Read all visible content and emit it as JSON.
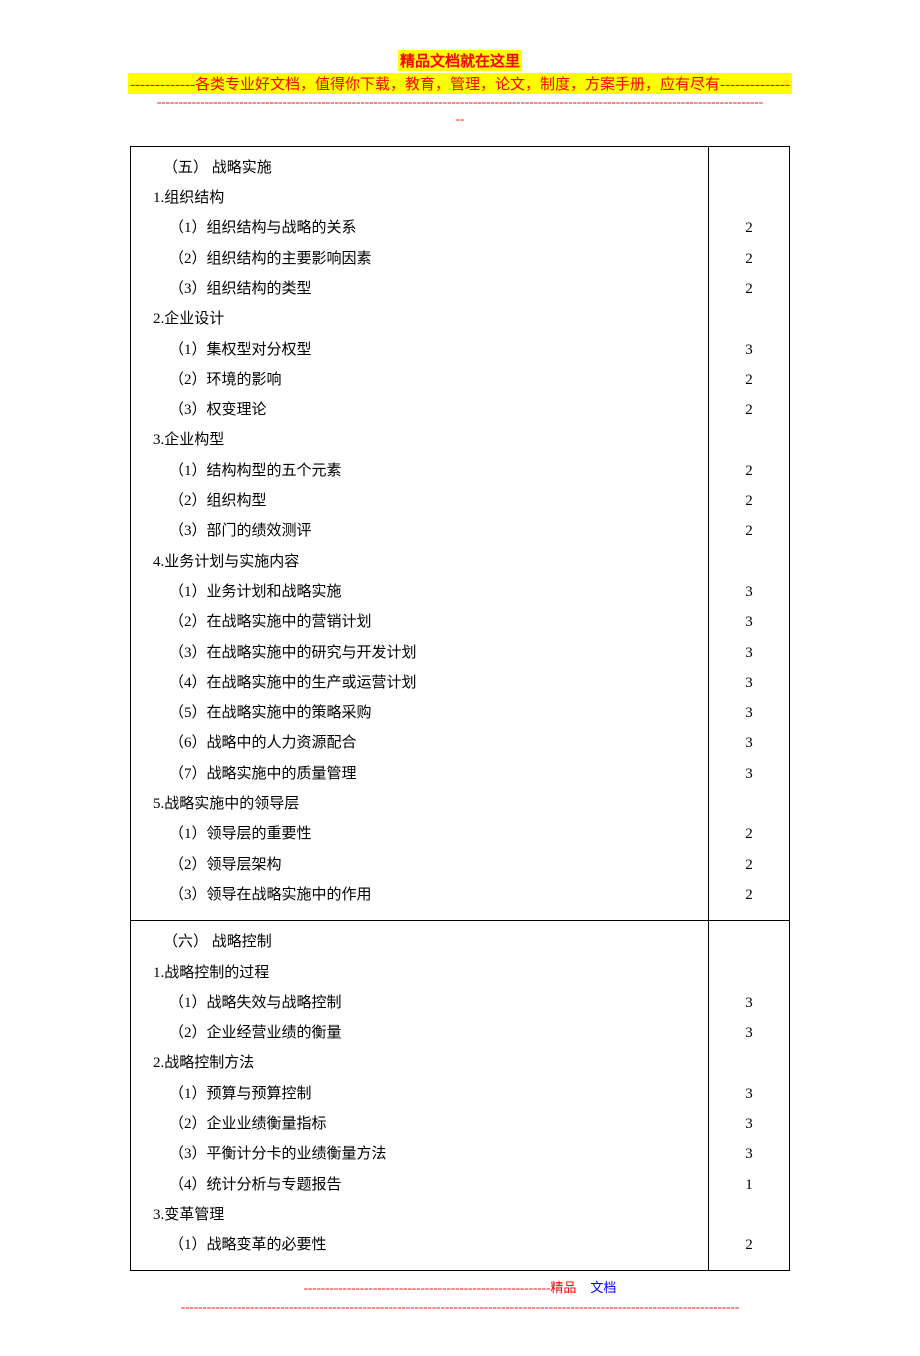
{
  "header": {
    "title": "精品文档就在这里",
    "subtitle": "-------------各类专业好文档，值得你下载，教育，管理，论文，制度，方案手册，应有尽有--------------",
    "dashes1": "--------------------------------------------------------------------------------------------------------------------------------------------",
    "dashes2": "--"
  },
  "sections": [
    {
      "heading": "（五） 战略实施",
      "groups": [
        {
          "title": "1.组织结构",
          "items": [
            {
              "label": "（1）组织结构与战略的关系",
              "value": "2"
            },
            {
              "label": "（2）组织结构的主要影响因素",
              "value": "2"
            },
            {
              "label": "（3）组织结构的类型",
              "value": "2"
            }
          ]
        },
        {
          "title": "2.企业设计",
          "items": [
            {
              "label": "（1）集权型对分权型",
              "value": "3"
            },
            {
              "label": "（2）环境的影响",
              "value": "2"
            },
            {
              "label": "（3）权变理论",
              "value": "2"
            }
          ]
        },
        {
          "title": "3.企业构型",
          "items": [
            {
              "label": "（1）结构构型的五个元素",
              "value": "2"
            },
            {
              "label": "（2）组织构型",
              "value": "2"
            },
            {
              "label": "（3）部门的绩效测评",
              "value": "2"
            }
          ]
        },
        {
          "title": "4.业务计划与实施内容",
          "items": [
            {
              "label": "（1）业务计划和战略实施",
              "value": "3"
            },
            {
              "label": "（2）在战略实施中的营销计划",
              "value": "3"
            },
            {
              "label": "（3）在战略实施中的研究与开发计划",
              "value": "3"
            },
            {
              "label": "（4）在战略实施中的生产或运营计划",
              "value": "3"
            },
            {
              "label": "（5）在战略实施中的策略采购",
              "value": "3"
            },
            {
              "label": "（6）战略中的人力资源配合",
              "value": "3"
            },
            {
              "label": "（7）战略实施中的质量管理",
              "value": "3"
            }
          ]
        },
        {
          "title": "5.战略实施中的领导层",
          "items": [
            {
              "label": "（1）领导层的重要性",
              "value": "2"
            },
            {
              "label": "（2）领导层架构",
              "value": "2"
            },
            {
              "label": "（3）领导在战略实施中的作用",
              "value": "2"
            }
          ]
        }
      ]
    },
    {
      "heading": "（六） 战略控制",
      "groups": [
        {
          "title": "1.战略控制的过程",
          "items": [
            {
              "label": "（1）战略失效与战略控制",
              "value": "3"
            },
            {
              "label": "（2）企业经营业绩的衡量",
              "value": "3"
            }
          ]
        },
        {
          "title": "2.战略控制方法",
          "items": [
            {
              "label": "（1）预算与预算控制",
              "value": "3"
            },
            {
              "label": "（2）企业业绩衡量指标",
              "value": "3"
            },
            {
              "label": "（3）平衡计分卡的业绩衡量方法",
              "value": "3"
            },
            {
              "label": "（4）统计分析与专题报告",
              "value": "1"
            }
          ]
        },
        {
          "title": "3.变革管理",
          "items": [
            {
              "label": "（1）战略变革的必要性",
              "value": "2"
            }
          ]
        }
      ]
    }
  ],
  "footer": {
    "dashes": "---------------------------------------------------------",
    "jingpin": "精品",
    "wendang": "文档",
    "dashes2": "---------------------------------------------------------------------------------------------------------------------------------"
  }
}
